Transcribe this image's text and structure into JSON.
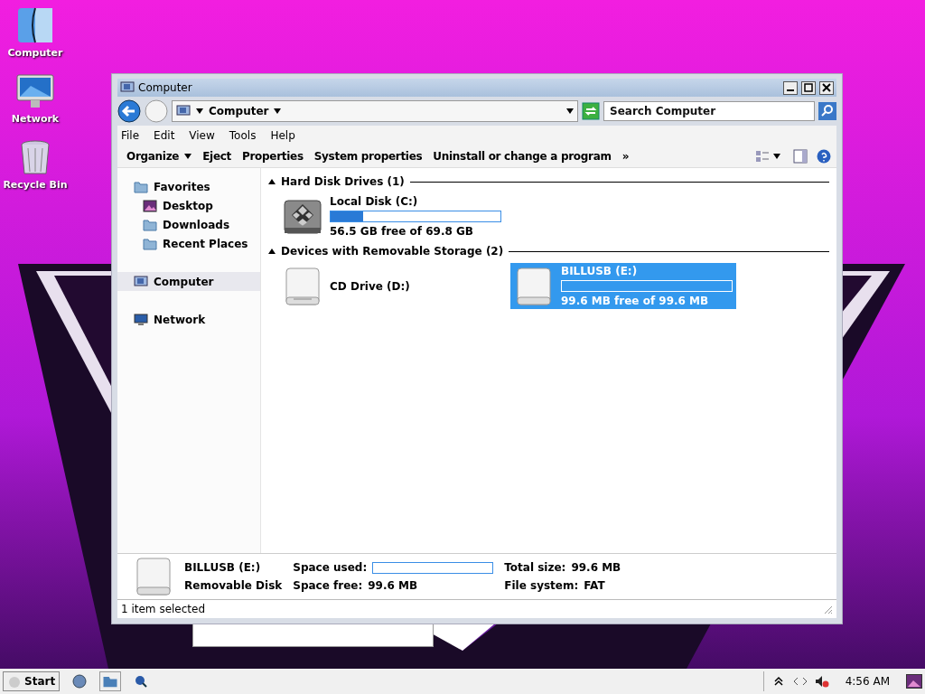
{
  "desktop_icons": [
    {
      "label": "Computer",
      "kind": "finder"
    },
    {
      "label": "Network",
      "kind": "monitor"
    },
    {
      "label": "Recycle Bin",
      "kind": "trash"
    }
  ],
  "window": {
    "title": "Computer",
    "address": "Computer",
    "search": {
      "placeholder": "Search Computer"
    },
    "menu": [
      "File",
      "Edit",
      "View",
      "Tools",
      "Help"
    ],
    "toolbar": [
      {
        "label": "Organize",
        "dropdown": true
      },
      {
        "label": "Eject",
        "dropdown": false
      },
      {
        "label": "Properties",
        "dropdown": false
      },
      {
        "label": "System properties",
        "dropdown": false
      },
      {
        "label": "Uninstall or change a program",
        "dropdown": false
      }
    ],
    "more": "»",
    "nav": [
      {
        "label": "Favorites",
        "kind": "folder",
        "selected": false,
        "children": [
          {
            "label": "Desktop",
            "kind": "desktop",
            "selected": false
          },
          {
            "label": "Downloads",
            "kind": "folder",
            "selected": false
          },
          {
            "label": "Recent Places",
            "kind": "folder",
            "selected": false
          }
        ]
      },
      {
        "label": "Computer",
        "kind": "computer",
        "selected": true
      },
      {
        "label": "Network",
        "kind": "monitor",
        "selected": false
      }
    ],
    "groups": [
      {
        "title": "Hard Disk Drives (1)",
        "items": [
          {
            "name": "Local Disk (C:)",
            "kind": "hdd",
            "level": 0.19,
            "free": "56.5 GB free of 69.8 GB",
            "selected": false
          }
        ]
      },
      {
        "title": "Devices with Removable Storage (2)",
        "items": [
          {
            "name": "CD Drive (D:)",
            "kind": "cd",
            "selected": false
          },
          {
            "name": "BILLUSB (E:)",
            "kind": "usb",
            "level": 0,
            "free": "99.6 MB free of 99.6 MB",
            "selected": true
          }
        ]
      }
    ],
    "details": {
      "name": "BILLUSB (E:)",
      "type": "Removable Disk",
      "used": {
        "label": "Space used:",
        "level": 0
      },
      "free_label": "Space free:",
      "free_value": "99.6 MB",
      "total_label": "Total size:",
      "total_value": "99.6 MB",
      "fs_label": "File system:",
      "fs_value": "FAT"
    },
    "status_bar": "1 item selected"
  },
  "taskbar": {
    "start": "Start",
    "clock": "4:56 AM"
  }
}
